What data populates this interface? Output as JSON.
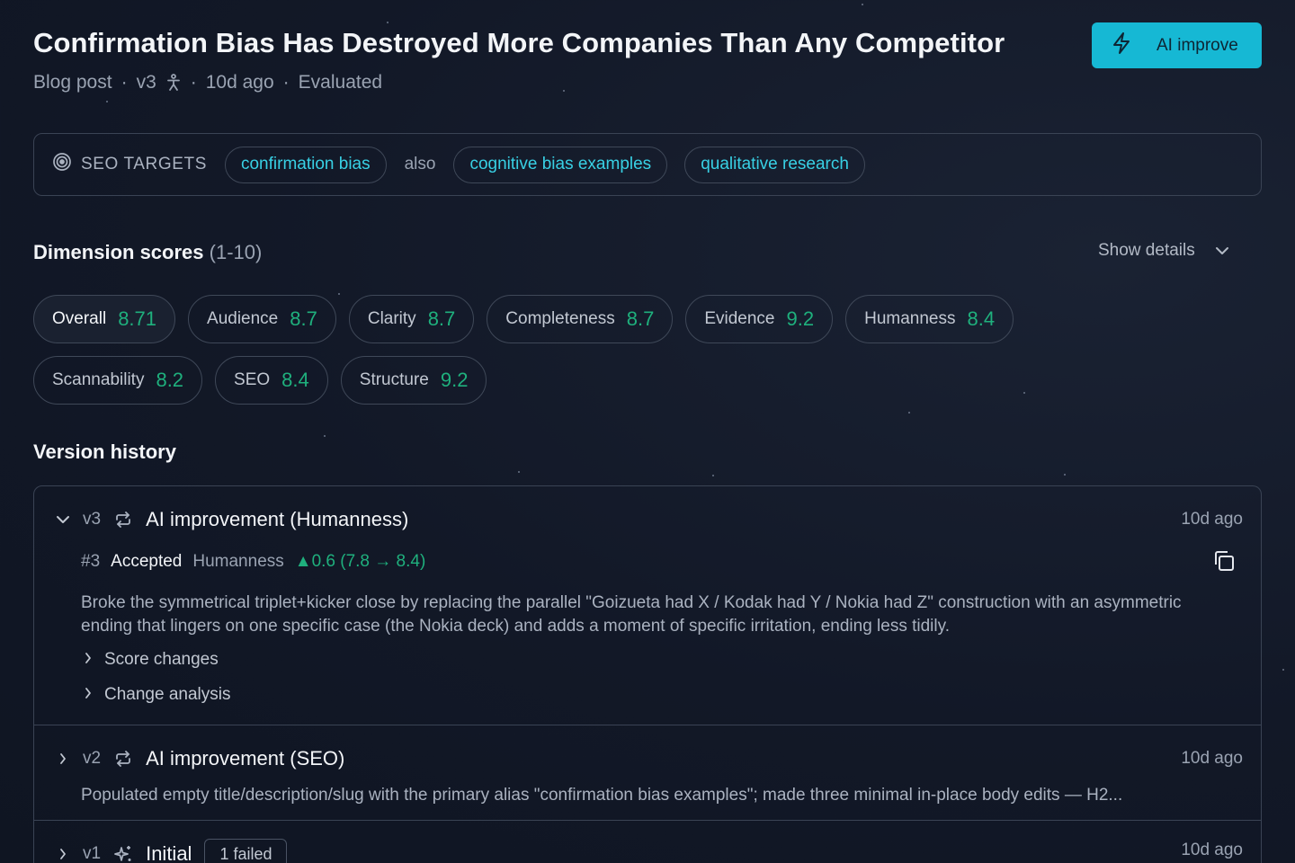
{
  "header": {
    "title": "Confirmation Bias Has Destroyed More Companies Than Any Competitor",
    "meta_type": "Blog post",
    "meta_version": "v3",
    "meta_age": "10d ago",
    "meta_status": "Evaluated",
    "ai_button_label": "AI improve"
  },
  "seo": {
    "label": "SEO TARGETS",
    "primary": "confirmation bias",
    "also_label": "also",
    "secondary": [
      "cognitive bias examples",
      "qualitative research"
    ]
  },
  "scores": {
    "heading": "Dimension scores",
    "range": "(1-10)",
    "show_details": "Show details",
    "items": [
      {
        "label": "Overall",
        "value": "8.71"
      },
      {
        "label": "Audience",
        "value": "8.7"
      },
      {
        "label": "Clarity",
        "value": "8.7"
      },
      {
        "label": "Completeness",
        "value": "8.7"
      },
      {
        "label": "Evidence",
        "value": "9.2"
      },
      {
        "label": "Humanness",
        "value": "8.4"
      },
      {
        "label": "Scannability",
        "value": "8.2"
      },
      {
        "label": "SEO",
        "value": "8.4"
      },
      {
        "label": "Structure",
        "value": "9.2"
      }
    ]
  },
  "history": {
    "heading": "Version history",
    "versions": [
      {
        "version": "v3",
        "title": "AI improvement (Humanness)",
        "time": "10d ago",
        "run_number": "#3",
        "status": "Accepted",
        "dimension": "Humanness",
        "delta": "▲0.6 (7.8 → 8.4)",
        "description": "Broke the symmetrical triplet+kicker close by replacing the parallel \"Goizueta had X / Kodak had Y / Nokia had Z\" construction with an asymmetric ending that lingers on one specific case (the Nokia deck) and adds a moment of specific irritation, ending less tidily.",
        "expander_scores": "Score changes",
        "expander_analysis": "Change analysis"
      },
      {
        "version": "v2",
        "title": "AI improvement (SEO)",
        "time": "10d ago",
        "summary": "Populated empty title/description/slug with the primary alias \"confirmation bias examples\"; made three minimal in-place body edits — H2..."
      },
      {
        "version": "v1",
        "title": "Initial",
        "badge": "1 failed",
        "time": "10d ago"
      }
    ]
  },
  "colors": {
    "accent": "#16b8d4",
    "score_green": "#1fb07d",
    "chip_text": "#38d0e4",
    "background": "#121827"
  }
}
